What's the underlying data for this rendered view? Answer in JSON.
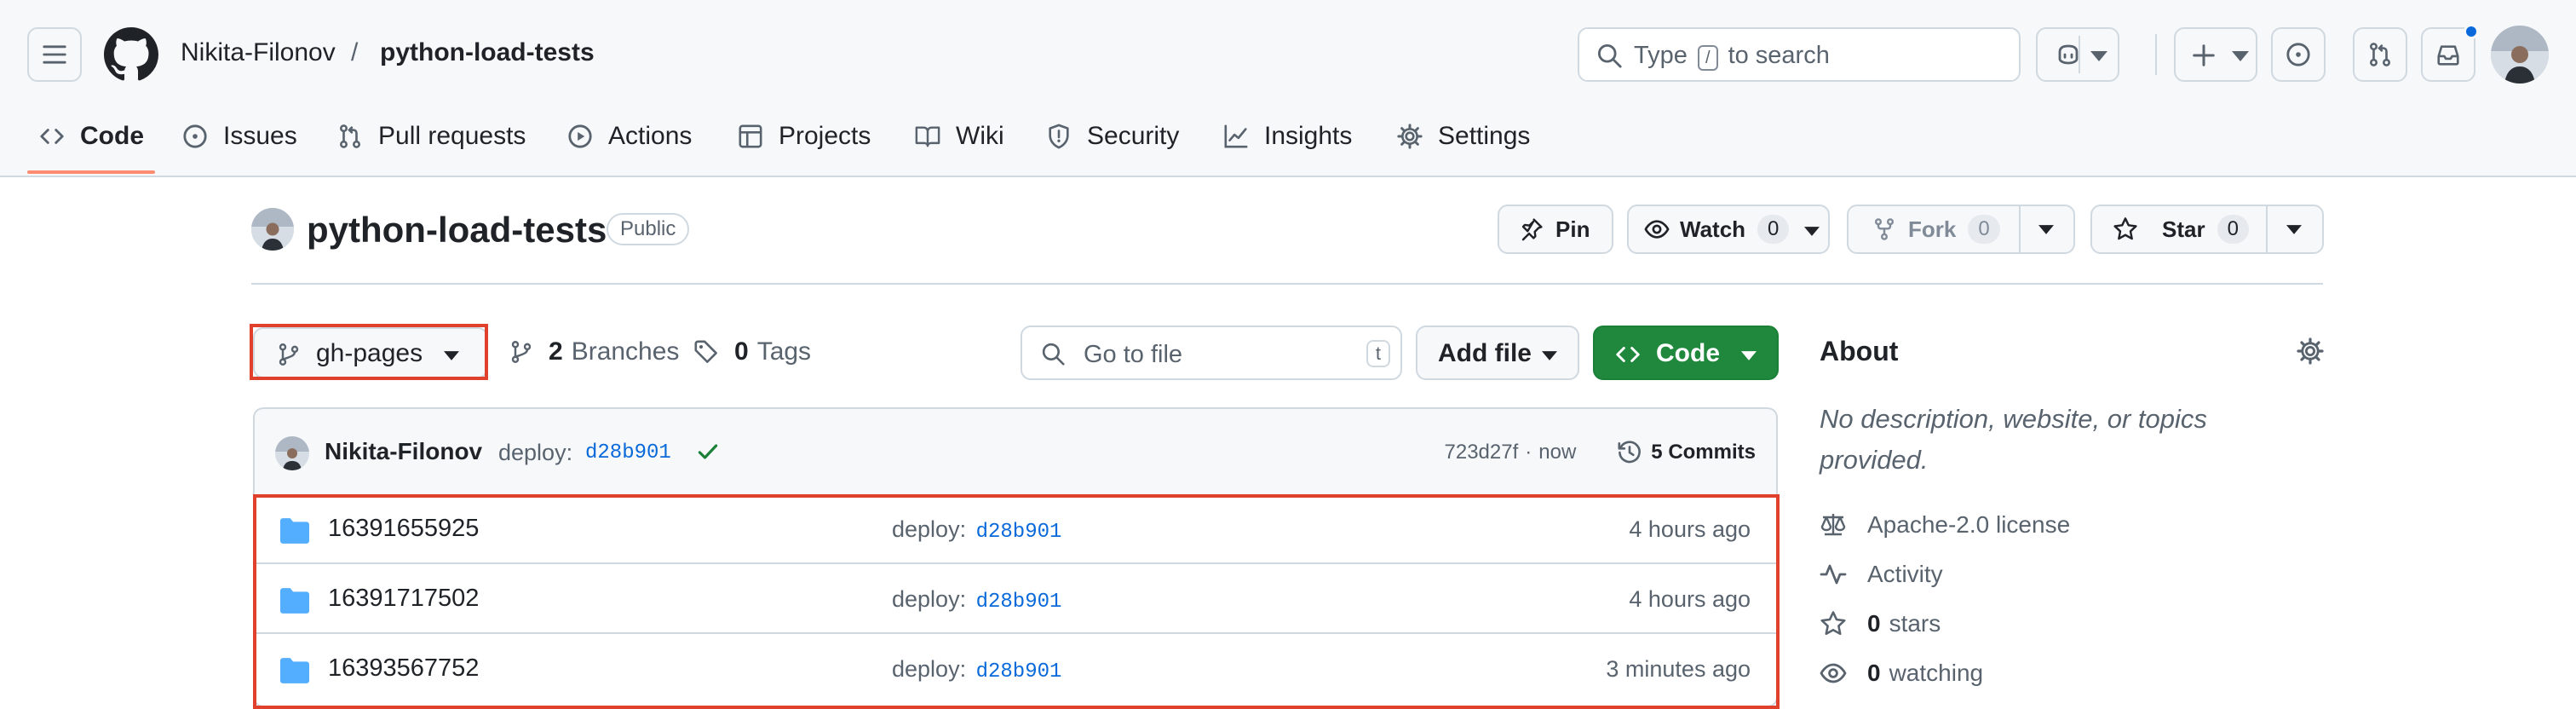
{
  "header": {
    "owner": "Nikita-Filonov",
    "separator": "/",
    "repo": "python-load-tests",
    "search_prefix": "Type",
    "search_key": "/",
    "search_suffix": "to search"
  },
  "nav": {
    "tabs": [
      {
        "label": "Code"
      },
      {
        "label": "Issues"
      },
      {
        "label": "Pull requests"
      },
      {
        "label": "Actions"
      },
      {
        "label": "Projects"
      },
      {
        "label": "Wiki"
      },
      {
        "label": "Security"
      },
      {
        "label": "Insights"
      },
      {
        "label": "Settings"
      }
    ]
  },
  "repo": {
    "title": "python-load-tests",
    "visibility": "Public",
    "pin_label": "Pin",
    "watch_label": "Watch",
    "watch_count": "0",
    "fork_label": "Fork",
    "fork_count": "0",
    "star_label": "Star",
    "star_count": "0"
  },
  "controls": {
    "branch": "gh-pages",
    "branches_count": "2",
    "branches_label": "Branches",
    "tags_count": "0",
    "tags_label": "Tags",
    "goto_placeholder": "Go to file",
    "goto_key": "t",
    "add_file": "Add file",
    "code": "Code"
  },
  "commit": {
    "author": "Nikita-Filonov",
    "message": "deploy:",
    "sha_link": "d28b901",
    "short_sha": "723d27f",
    "time": "now",
    "commits_label": "5 Commits"
  },
  "files": [
    {
      "name": "16391655925",
      "message": "deploy:",
      "sha": "d28b901",
      "age": "4 hours ago"
    },
    {
      "name": "16391717502",
      "message": "deploy:",
      "sha": "d28b901",
      "age": "4 hours ago"
    },
    {
      "name": "16393567752",
      "message": "deploy:",
      "sha": "d28b901",
      "age": "3 minutes ago"
    }
  ],
  "about": {
    "title": "About",
    "description": "No description, website, or topics provided.",
    "license": "Apache-2.0 license",
    "activity": "Activity",
    "stars_count": "0",
    "stars_label": "stars",
    "watching_count": "0",
    "watching_label": "watching"
  },
  "colors": {
    "accent_green": "#1f883d",
    "link_blue": "#0969da",
    "highlight_red": "#e0412c",
    "nav_underline": "#fd8c73",
    "folder_blue": "#54aeff"
  }
}
